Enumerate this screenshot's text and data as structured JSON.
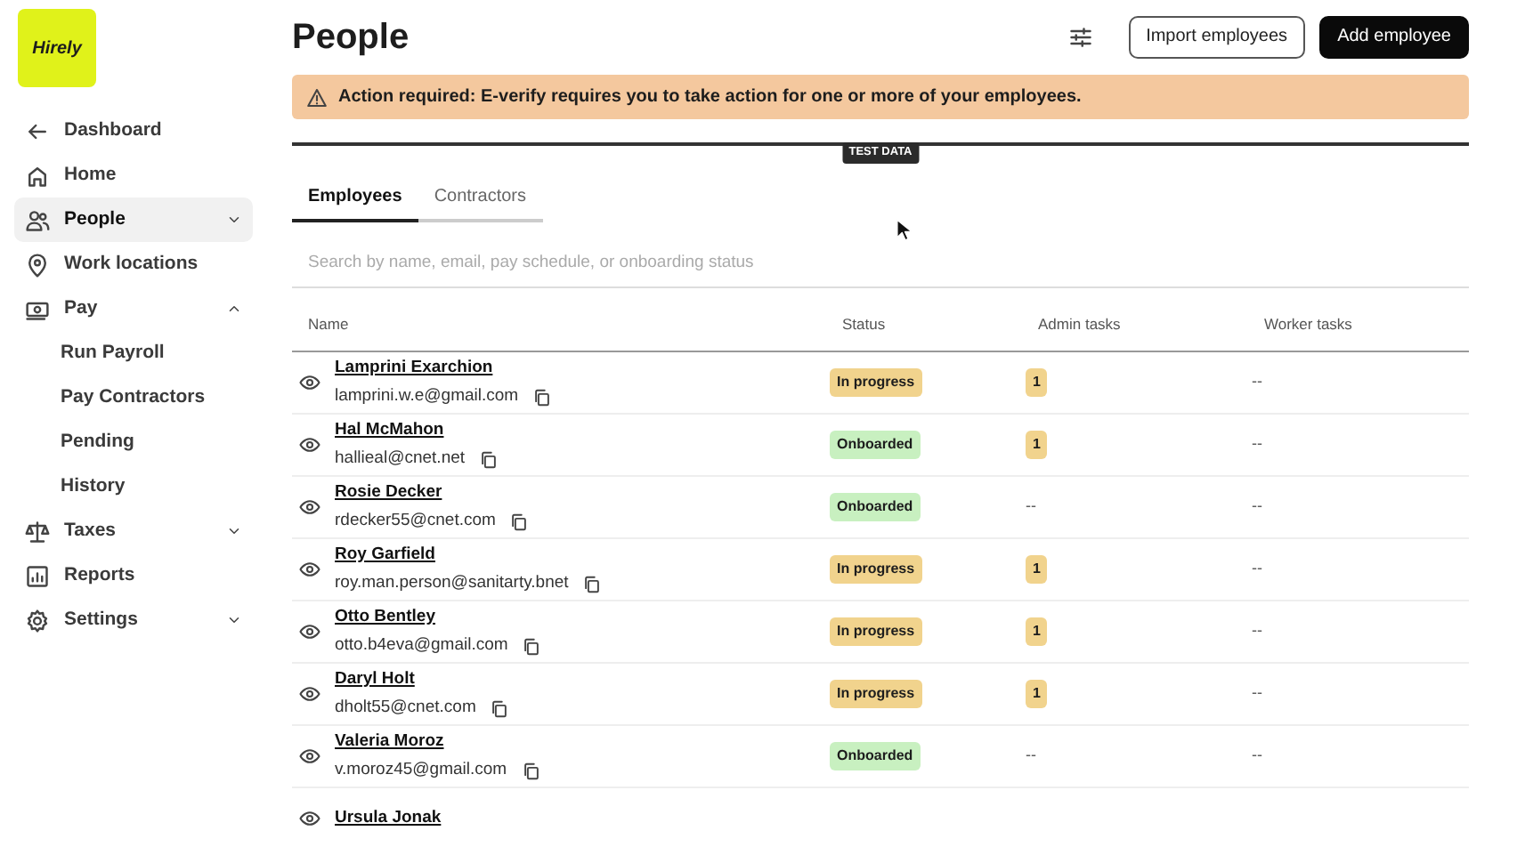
{
  "logo": {
    "text": "Hirely"
  },
  "sidebar": {
    "items": [
      {
        "label": "Dashboard",
        "kind": "back",
        "selected": false
      },
      {
        "label": "Home",
        "kind": "item",
        "selected": false
      },
      {
        "label": "People",
        "kind": "group",
        "selected": true,
        "expanded": false
      },
      {
        "label": "Work locations",
        "kind": "item",
        "selected": false
      },
      {
        "label": "Pay",
        "kind": "group",
        "selected": false,
        "expanded": true,
        "children": [
          {
            "label": "Run Payroll"
          },
          {
            "label": "Pay Contractors"
          },
          {
            "label": "Pending"
          },
          {
            "label": "History"
          }
        ]
      },
      {
        "label": "Taxes",
        "kind": "group",
        "selected": false,
        "expanded": false
      },
      {
        "label": "Reports",
        "kind": "item",
        "selected": false
      },
      {
        "label": "Settings",
        "kind": "group",
        "selected": false,
        "expanded": false
      }
    ]
  },
  "page": {
    "title": "People",
    "buttons": [
      {
        "label": "Import employees",
        "kind": "outline"
      },
      {
        "label": "Add employee",
        "kind": "primary"
      }
    ]
  },
  "alert": {
    "text": "Action required: E-verify requires you to take action for one or more of your employees."
  },
  "test_data_label": "TEST DATA",
  "tabs": [
    {
      "label": "Employees",
      "selected": true
    },
    {
      "label": "Contractors",
      "selected": false
    }
  ],
  "search": {
    "placeholder": "Search by name, email, pay schedule, or onboarding status"
  },
  "table": {
    "columns": [
      "Name",
      "Status",
      "Admin tasks",
      "Worker tasks"
    ],
    "rows": [
      {
        "name": "Lamprini Exarchion",
        "email": "lamprini.w.e@gmail.com",
        "status": {
          "label": "In progress",
          "kind": "progress"
        },
        "admin_tasks": {
          "text": "1",
          "kind": "badge"
        },
        "worker_tasks": "--"
      },
      {
        "name": "Hal McMahon",
        "email": "hallieal@cnet.net",
        "status": {
          "label": "Onboarded",
          "kind": "done"
        },
        "admin_tasks": {
          "text": "1",
          "kind": "badge"
        },
        "worker_tasks": "--"
      },
      {
        "name": "Rosie Decker",
        "email": "rdecker55@cnet.com",
        "status": {
          "label": "Onboarded",
          "kind": "done"
        },
        "admin_tasks": {
          "text": "--",
          "kind": "plain"
        },
        "worker_tasks": "--"
      },
      {
        "name": "Roy Garfield",
        "email": "roy.man.person@sanitarty.bnet",
        "status": {
          "label": "In progress",
          "kind": "progress"
        },
        "admin_tasks": {
          "text": "1",
          "kind": "badge"
        },
        "worker_tasks": "--"
      },
      {
        "name": "Otto Bentley",
        "email": "otto.b4eva@gmail.com",
        "status": {
          "label": "In progress",
          "kind": "progress"
        },
        "admin_tasks": {
          "text": "1",
          "kind": "badge"
        },
        "worker_tasks": "--"
      },
      {
        "name": "Daryl Holt",
        "email": "dholt55@cnet.com",
        "status": {
          "label": "In progress",
          "kind": "progress"
        },
        "admin_tasks": {
          "text": "1",
          "kind": "badge"
        },
        "worker_tasks": "--"
      },
      {
        "name": "Valeria Moroz",
        "email": "v.moroz45@gmail.com",
        "status": {
          "label": "Onboarded",
          "kind": "done"
        },
        "admin_tasks": {
          "text": "--",
          "kind": "plain"
        },
        "worker_tasks": "--"
      },
      {
        "name": "Ursula Jonak"
      }
    ]
  }
}
